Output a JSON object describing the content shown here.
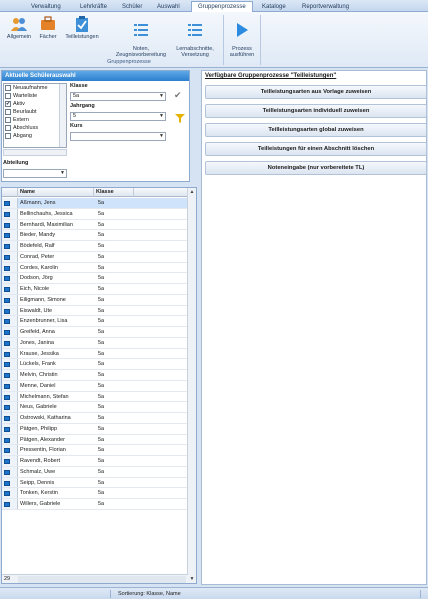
{
  "tabs": [
    {
      "label": "Verwaltung"
    },
    {
      "label": "Lehrkräfte"
    },
    {
      "label": "Schüler"
    },
    {
      "label": "Auswahl"
    },
    {
      "label": "Gruppenprozesse",
      "active": true
    },
    {
      "label": "Kataloge"
    },
    {
      "label": "Reportverwaltung"
    }
  ],
  "ribbon": {
    "buttons": [
      {
        "label": "Allgemein",
        "icon": "people-icon"
      },
      {
        "label": "Fächer",
        "icon": "briefcase-icon"
      },
      {
        "label": "Teilleistungen",
        "icon": "clipboard-check-icon"
      },
      {
        "label": "Noten,\nZeugnisvorbereitung",
        "icon": "list-icon"
      },
      {
        "label": "Lernabschnitte,\nVersetzung",
        "icon": "list-icon"
      },
      {
        "label": "Prozess\nausführen",
        "icon": "play-icon"
      }
    ],
    "group_caption": "Gruppenprozesse"
  },
  "filter": {
    "title": "Aktuelle Schülerauswahl",
    "status_items": [
      {
        "label": "Neuaufnahme",
        "checked": false
      },
      {
        "label": "Warteliste",
        "checked": false
      },
      {
        "label": "Aktiv",
        "checked": true
      },
      {
        "label": "Beurlaubt",
        "checked": false
      },
      {
        "label": "Extern",
        "checked": false
      },
      {
        "label": "Abschluss",
        "checked": false
      },
      {
        "label": "Abgang",
        "checked": false
      }
    ],
    "klasse_label": "Klasse",
    "klasse_value": "5a",
    "jahrgang_label": "Jahrgang",
    "jahrgang_value": "5",
    "kurs_label": "Kurs",
    "kurs_value": "",
    "abteilung_label": "Abteilung",
    "abteilung_value": ""
  },
  "grid": {
    "columns": [
      "Name",
      "Klasse"
    ],
    "rows": [
      {
        "name": "Aßmann, Jens",
        "klasse": "5a"
      },
      {
        "name": "Bellinchauhs, Jessica",
        "klasse": "5a"
      },
      {
        "name": "Bernhardi, Maximilian",
        "klasse": "5a"
      },
      {
        "name": "Bieder, Mandy",
        "klasse": "5a"
      },
      {
        "name": "Bödefeld, Ralf",
        "klasse": "5a"
      },
      {
        "name": "Conrad, Peter",
        "klasse": "5a"
      },
      {
        "name": "Cordes, Karolin",
        "klasse": "5a"
      },
      {
        "name": "Dodson, Jörg",
        "klasse": "5a"
      },
      {
        "name": "Eich, Nicole",
        "klasse": "5a"
      },
      {
        "name": "Eiligmann, Simone",
        "klasse": "5a"
      },
      {
        "name": "Eiswaldt, Ute",
        "klasse": "5a"
      },
      {
        "name": "Enzenbrunner, Lisa",
        "klasse": "5a"
      },
      {
        "name": "Greifeld, Anna",
        "klasse": "5a"
      },
      {
        "name": "Jones, Janina",
        "klasse": "5a"
      },
      {
        "name": "Krause, Jessika",
        "klasse": "5a"
      },
      {
        "name": "Lückels, Frank",
        "klasse": "5a"
      },
      {
        "name": "Melvin, Christin",
        "klasse": "5a"
      },
      {
        "name": "Menne, Daniel",
        "klasse": "5a"
      },
      {
        "name": "Michelmann, Stefan",
        "klasse": "5a"
      },
      {
        "name": "Neus, Gabriele",
        "klasse": "5a"
      },
      {
        "name": "Ostrowski, Katharina",
        "klasse": "5a"
      },
      {
        "name": "Pätgen, Philipp",
        "klasse": "5a"
      },
      {
        "name": "Pätgen, Alexander",
        "klasse": "5a"
      },
      {
        "name": "Pressentin, Florian",
        "klasse": "5a"
      },
      {
        "name": "Ravendt, Robert",
        "klasse": "5a"
      },
      {
        "name": "Schmalz, Uwe",
        "klasse": "5a"
      },
      {
        "name": "Seipp, Dennis",
        "klasse": "5a"
      },
      {
        "name": "Tonken, Kerstin",
        "klasse": "5a"
      },
      {
        "name": "Willers, Gabriele",
        "klasse": "5a"
      }
    ],
    "count": "29"
  },
  "right": {
    "title": "Verfügbare Gruppenprozesse \"Teilleistungen\"",
    "actions": [
      "Teilleistungsarten aus Vorlage zuweisen",
      "Teilleistungsarten individuell zuweisen",
      "Teilleistungsarten global zuweisen",
      "Teilleistungen für einen Abschnitt löschen",
      "Noteneingabe (nur vorbereitete TL)"
    ]
  },
  "statusbar": {
    "sort_text": "Sortierung: Klasse, Name"
  },
  "colors": {
    "accent": "#2c7fcf",
    "selection": "#cfe3fb",
    "ribbon_bg": "#dfe9f5"
  }
}
